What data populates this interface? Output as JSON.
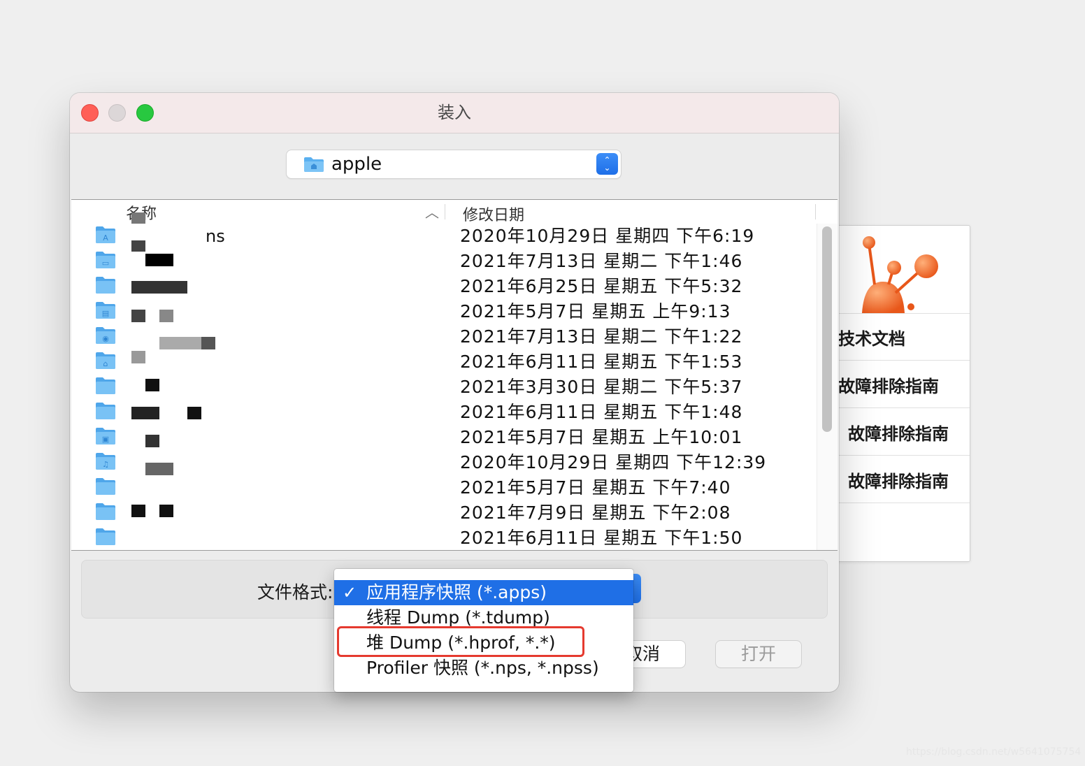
{
  "colors": {
    "accent": "#1f6fe6",
    "highlight_border": "#e53a2f",
    "folder": "#5ab0f0"
  },
  "background_app": {
    "links": [
      "技术文档",
      "故障排除指南",
      "故障排除指南",
      "故障排除指南"
    ]
  },
  "window": {
    "title": "装入"
  },
  "location": {
    "folder_name": "apple"
  },
  "file_list": {
    "columns": {
      "name": "名称",
      "date": "修改日期"
    },
    "rows": [
      {
        "name": "ns",
        "date": "2020年10月29日 星期四 下午6:19",
        "icon": "applications-folder-icon"
      },
      {
        "name": "",
        "date": "2021年7月13日 星期二 下午1:46",
        "icon": "desktop-folder-icon"
      },
      {
        "name": "",
        "date": "2021年6月25日 星期五 下午5:32",
        "icon": "folder-icon"
      },
      {
        "name": "",
        "date": "2021年5月7日 星期五 上午9:13",
        "icon": "documents-folder-icon"
      },
      {
        "name": "",
        "date": "2021年7月13日 星期二 下午1:22",
        "icon": "downloads-folder-icon"
      },
      {
        "name": "",
        "date": "2021年6月11日 星期五 下午1:53",
        "icon": "library-folder-icon"
      },
      {
        "name": "",
        "date": "2021年3月30日 星期二 下午5:37",
        "icon": "folder-icon"
      },
      {
        "name": "",
        "date": "2021年6月11日 星期五 下午1:48",
        "icon": "folder-icon"
      },
      {
        "name": "",
        "date": "2021年5月7日 星期五 上午10:01",
        "icon": "movies-folder-icon"
      },
      {
        "name": "",
        "date": "2020年10月29日 星期四 下午12:39",
        "icon": "music-folder-icon"
      },
      {
        "name": "",
        "date": "2021年5月7日 星期五 下午7:40",
        "icon": "folder-icon"
      },
      {
        "name": "",
        "date": "2021年7月9日 星期五 下午2:08",
        "icon": "folder-icon"
      },
      {
        "name": "",
        "date": "2021年6月11日 星期五 下午1:50",
        "icon": "folder-icon"
      }
    ]
  },
  "file_format": {
    "label": "文件格式:",
    "options": [
      "应用程序快照 (*.apps)",
      "线程 Dump (*.tdump)",
      "堆 Dump (*.hprof, *.*)",
      "Profiler 快照 (*.nps, *.npss)"
    ],
    "selected_index": 0,
    "highlighted_index": 2
  },
  "buttons": {
    "cancel": "取消",
    "open": "打开"
  },
  "watermark": "https://blog.csdn.net/w5641075754"
}
